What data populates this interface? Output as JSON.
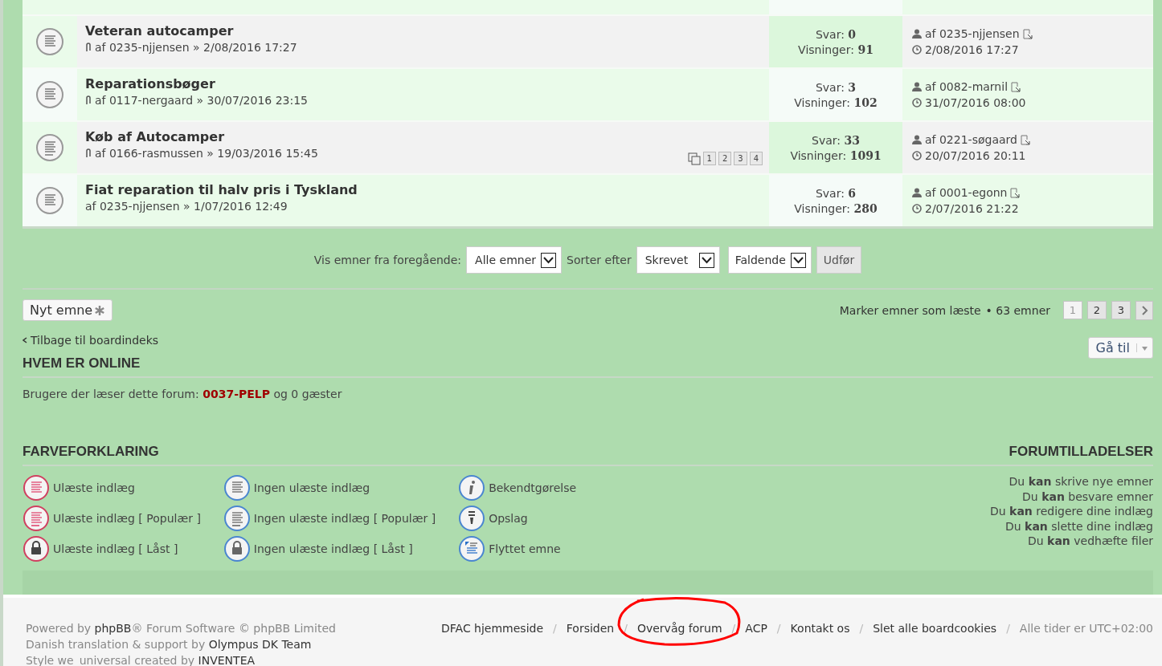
{
  "topics": [
    {
      "kind": "normal",
      "title": "Veteran autocamper",
      "author": "af 0235-njjensen » 2/08/2016 17:27",
      "attachment": true,
      "replies_label": "Svar:",
      "replies": "0",
      "views_label": "Visninger:",
      "views": "91",
      "last_author": "af 0235-njjensen",
      "last_date": "2/08/2016 17:27"
    },
    {
      "kind": "normal",
      "title": "Reparationsbøger",
      "author": "af 0117-nergaard » 30/07/2016 23:15",
      "attachment": true,
      "replies_label": "Svar:",
      "replies": "3",
      "views_label": "Visninger:",
      "views": "102",
      "last_author": "af 0082-marnil",
      "last_date": "31/07/2016 08:00"
    },
    {
      "kind": "hot",
      "title": "Køb af Autocamper",
      "author": "af 0166-rasmussen » 19/03/2016 15:45",
      "attachment": true,
      "pages": [
        "1",
        "2",
        "3",
        "4"
      ],
      "replies_label": "Svar:",
      "replies": "33",
      "views_label": "Visninger:",
      "views": "1091",
      "last_author": "af 0221-søgaard",
      "last_date": "20/07/2016 20:11"
    },
    {
      "kind": "normal",
      "title": "Fiat reparation til halv pris i Tyskland",
      "author": "af 0235-njjensen » 1/07/2016 12:49",
      "attachment": false,
      "replies_label": "Svar:",
      "replies": "6",
      "views_label": "Visninger:",
      "views": "280",
      "last_author": "af 0001-egonn",
      "last_date": "2/07/2016 21:22"
    }
  ],
  "sort_bar": {
    "label_show": "Vis emner fra foregående:",
    "show_value": "Alle emner",
    "label_sort": "Sorter efter",
    "sort_value": "Skrevet",
    "order_value": "Faldende",
    "submit": "Udfør"
  },
  "new_topic": "Nyt emne",
  "mark_read": "Marker emner som læste",
  "topic_count": "• 63 emner",
  "pagination": [
    {
      "label": "1",
      "selected": true
    },
    {
      "label": "2",
      "selected": false
    },
    {
      "label": "3",
      "selected": false
    }
  ],
  "back_link": "Tilbage til boardindeks",
  "jump": "Gå til",
  "online": {
    "title": "HVEM ER ONLINE",
    "text": "Brugere der læser dette forum:",
    "user": "0037-PELP",
    "rest": "og 0 gæster"
  },
  "legend": {
    "title": "FARVEFORKLARING",
    "columns": [
      [
        {
          "kind": "unread",
          "label": "Ulæste indlæg"
        },
        {
          "kind": "unread_hot",
          "label": "Ulæste indlæg [ Populær ]"
        },
        {
          "kind": "unread_locked",
          "label": "Ulæste indlæg [ Låst ]"
        }
      ],
      [
        {
          "kind": "read",
          "label": "Ingen ulæste indlæg"
        },
        {
          "kind": "read_hot",
          "label": "Ingen ulæste indlæg [ Populær ]"
        },
        {
          "kind": "read_locked",
          "label": "Ingen ulæste indlæg [ Låst ]"
        }
      ],
      [
        {
          "kind": "announce",
          "label": "Bekendtgørelse"
        },
        {
          "kind": "sticky",
          "label": "Opslag"
        },
        {
          "kind": "moved",
          "label": "Flyttet emne"
        }
      ]
    ]
  },
  "permissions": {
    "title": "FORUMTILLADELSER",
    "items": [
      "Du **kan** skrive nye emner",
      "Du **kan** besvare emner",
      "Du **kan** redigere dine indlæg",
      "Du **kan** slette dine indlæg",
      "Du **kan** vedhæfte filer"
    ]
  },
  "footer": {
    "credits": [
      {
        "before": "Powered by",
        "link": "phpBB",
        "after": "® Forum Software © phpBB Limited"
      },
      {
        "before": "Danish translation & support by",
        "link": "Olympus DK Team"
      },
      {
        "before": "Style we_universal created by",
        "link": "INVENTEA"
      }
    ],
    "links": [
      {
        "label": "DFAC hjemmeside",
        "circled": false
      },
      {
        "label": "Forsiden",
        "circled": false
      },
      {
        "label": "Overvåg forum",
        "circled": true
      },
      {
        "label": "ACP",
        "circled": false
      },
      {
        "label": "Kontakt os",
        "circled": false
      },
      {
        "label": "Slet alle boardcookies",
        "circled": false
      }
    ],
    "separator": "/",
    "timezone": "Alle tider er UTC+02:00"
  }
}
